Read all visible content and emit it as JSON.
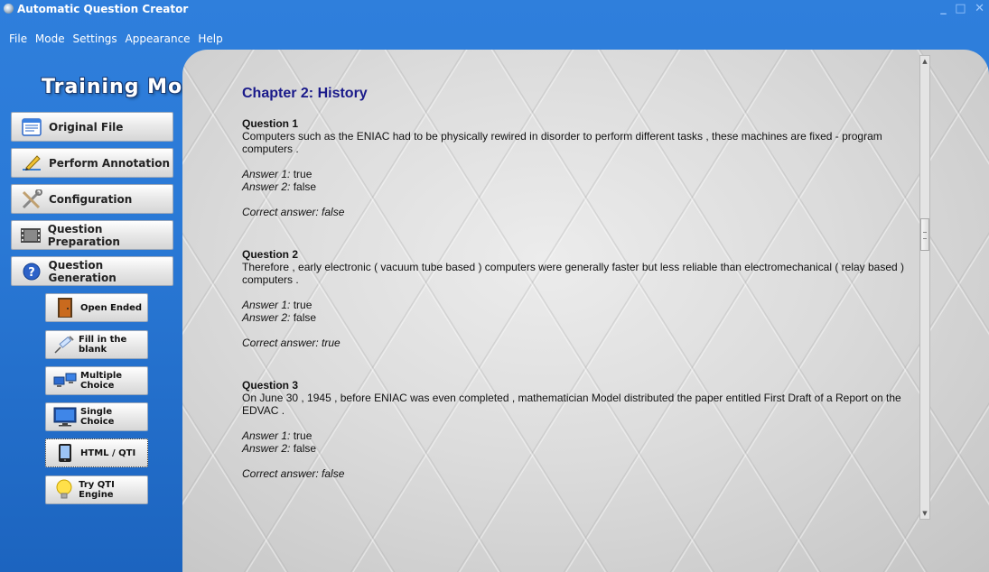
{
  "window": {
    "title": "Automatic Question Creator",
    "controls": [
      "_",
      "□",
      "✕"
    ]
  },
  "menu": [
    "File",
    "Mode",
    "Settings",
    "Appearance",
    "Help"
  ],
  "sidebar": {
    "mode_title": "Training Mode",
    "buttons": [
      {
        "label": "Original File",
        "icon": "document-icon"
      },
      {
        "label": "Perform Annotation",
        "icon": "annotation-pen-icon"
      },
      {
        "label": "Configuration",
        "icon": "tools-icon"
      },
      {
        "label": "Question Preparation",
        "icon": "film-icon"
      },
      {
        "label": "Question Generation",
        "icon": "help-icon"
      }
    ],
    "sub_buttons": [
      {
        "label": "Open Ended",
        "icon": "door-icon"
      },
      {
        "label": "Fill in the blank",
        "icon": "syringe-icon"
      },
      {
        "label": "Multiple Choice",
        "icon": "network-icon"
      },
      {
        "label": "Single Choice",
        "icon": "monitor-icon"
      },
      {
        "label": "HTML / QTI",
        "icon": "device-icon"
      },
      {
        "label": "Try QTI Engine",
        "icon": "lightbulb-icon"
      }
    ]
  },
  "content": {
    "chapter": "Chapter 2: History",
    "answer_1_prefix": "Answer 1:",
    "answer_2_prefix": "Answer 2:",
    "correct_prefix": "Correct answer:",
    "questions": [
      {
        "title": "Question 1",
        "text": "Computers such as the ENIAC had to be physically rewired in disorder to perform different tasks , these machines are fixed - program computers .",
        "answer1": "true",
        "answer2": "false",
        "correct": "false"
      },
      {
        "title": "Question 2",
        "text": "Therefore , early electronic ( vacuum tube based ) computers were generally faster but less reliable than electromechanical ( relay based ) computers .",
        "answer1": "true",
        "answer2": "false",
        "correct": "true"
      },
      {
        "title": "Question 3",
        "text": "On June 30 , 1945 , before ENIAC was even completed , mathematician Model distributed the paper entitled First Draft of a Report on the EDVAC .",
        "answer1": "true",
        "answer2": "false",
        "correct": "false"
      }
    ]
  }
}
